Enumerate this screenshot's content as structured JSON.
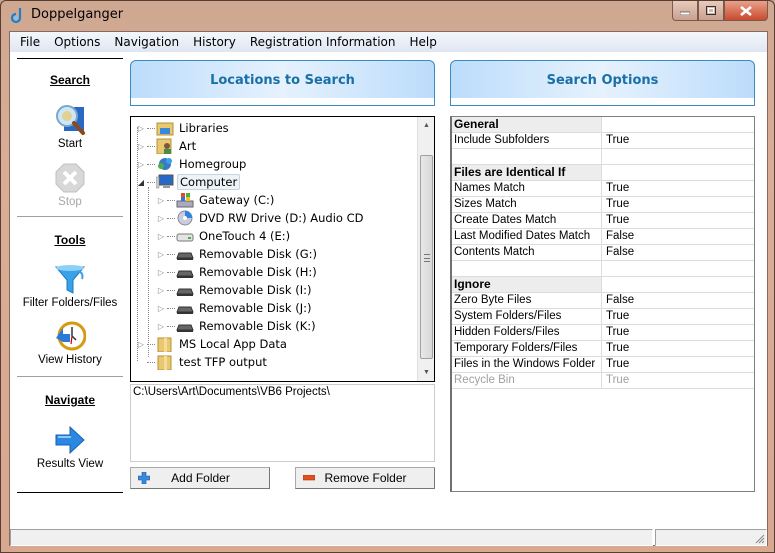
{
  "window": {
    "title": "Doppelganger",
    "app_icon": "doppelganger-app-icon",
    "controls": {
      "minimize": "minimize-icon",
      "maximize": "maximize-icon",
      "close": "close-icon"
    }
  },
  "menu": {
    "items": [
      "File",
      "Options",
      "Navigation",
      "History",
      "Registration Information",
      "Help"
    ]
  },
  "sidebar": {
    "sections": [
      {
        "heading": "Search",
        "buttons": [
          {
            "label": "Start",
            "icon": "magnifier-icon",
            "enabled": true
          },
          {
            "label": "Stop",
            "icon": "stop-icon",
            "enabled": false
          }
        ]
      },
      {
        "heading": "Tools",
        "buttons": [
          {
            "label": "Filter Folders/Files",
            "icon": "funnel-icon",
            "enabled": true
          },
          {
            "label": "View History",
            "icon": "history-clock-icon",
            "enabled": true
          }
        ]
      },
      {
        "heading": "Navigate",
        "buttons": [
          {
            "label": "Results View",
            "icon": "arrow-right-icon",
            "enabled": true
          }
        ]
      }
    ]
  },
  "locations": {
    "header": "Locations to Search",
    "tree": [
      {
        "label": "Libraries",
        "icon": "libraries-icon",
        "level": 0,
        "expander": "collapsed"
      },
      {
        "label": "Art",
        "icon": "user-folder-icon",
        "level": 0,
        "expander": "collapsed"
      },
      {
        "label": "Homegroup",
        "icon": "homegroup-icon",
        "level": 0,
        "expander": "collapsed"
      },
      {
        "label": "Computer",
        "icon": "computer-icon",
        "level": 0,
        "expander": "expanded",
        "selected": true
      },
      {
        "label": "Gateway (C:)",
        "icon": "windows-drive-icon",
        "level": 1,
        "expander": "collapsed"
      },
      {
        "label": "DVD RW Drive (D:) Audio CD",
        "icon": "cd-drive-icon",
        "level": 1,
        "expander": "collapsed"
      },
      {
        "label": "OneTouch 4 (E:)",
        "icon": "external-drive-icon",
        "level": 1,
        "expander": "collapsed"
      },
      {
        "label": "Removable Disk (G:)",
        "icon": "removable-disk-icon",
        "level": 1,
        "expander": "collapsed"
      },
      {
        "label": "Removable Disk (H:)",
        "icon": "removable-disk-icon",
        "level": 1,
        "expander": "collapsed"
      },
      {
        "label": "Removable Disk (I:)",
        "icon": "removable-disk-icon",
        "level": 1,
        "expander": "collapsed"
      },
      {
        "label": "Removable Disk (J:)",
        "icon": "removable-disk-icon",
        "level": 1,
        "expander": "collapsed"
      },
      {
        "label": "Removable Disk (K:)",
        "icon": "removable-disk-icon",
        "level": 1,
        "expander": "collapsed"
      },
      {
        "label": "MS Local App Data",
        "icon": "folder-icon",
        "level": 0,
        "expander": "collapsed"
      },
      {
        "label": "test TFP output",
        "icon": "folder-icon",
        "level": 0,
        "expander": "none"
      }
    ],
    "selected_paths": [
      "C:\\Users\\Art\\Documents\\VB6 Projects\\"
    ],
    "add_button": "Add Folder",
    "remove_button": "Remove Folder"
  },
  "search_options": {
    "header": "Search Options",
    "rows": [
      {
        "type": "category",
        "key": "General",
        "value": ""
      },
      {
        "type": "prop",
        "key": "Include Subfolders",
        "value": "True"
      },
      {
        "type": "blank",
        "key": "",
        "value": ""
      },
      {
        "type": "category",
        "key": "Files are Identical If",
        "value": ""
      },
      {
        "type": "prop",
        "key": "Names Match",
        "value": "True"
      },
      {
        "type": "prop",
        "key": "Sizes Match",
        "value": "True"
      },
      {
        "type": "prop",
        "key": "Create Dates Match",
        "value": "True"
      },
      {
        "type": "prop",
        "key": "Last Modified Dates Match",
        "value": "False"
      },
      {
        "type": "prop",
        "key": "Contents Match",
        "value": "False"
      },
      {
        "type": "blank",
        "key": "",
        "value": ""
      },
      {
        "type": "category",
        "key": "Ignore",
        "value": ""
      },
      {
        "type": "prop",
        "key": "Zero Byte Files",
        "value": "False"
      },
      {
        "type": "prop",
        "key": "System Folders/Files",
        "value": "True"
      },
      {
        "type": "prop",
        "key": "Hidden Folders/Files",
        "value": "True"
      },
      {
        "type": "prop",
        "key": "Temporary Folders/Files",
        "value": "True"
      },
      {
        "type": "prop",
        "key": "Files in the Windows Folder",
        "value": "True"
      },
      {
        "type": "prop",
        "key": "Recycle Bin",
        "value": "True",
        "disabled": true
      }
    ]
  },
  "statusbar": {
    "panes": [
      "",
      ""
    ]
  },
  "colors": {
    "header_text": "#1a6fa8",
    "header_border": "#3a8cc0",
    "disabled_text": "#a0a0a0"
  }
}
